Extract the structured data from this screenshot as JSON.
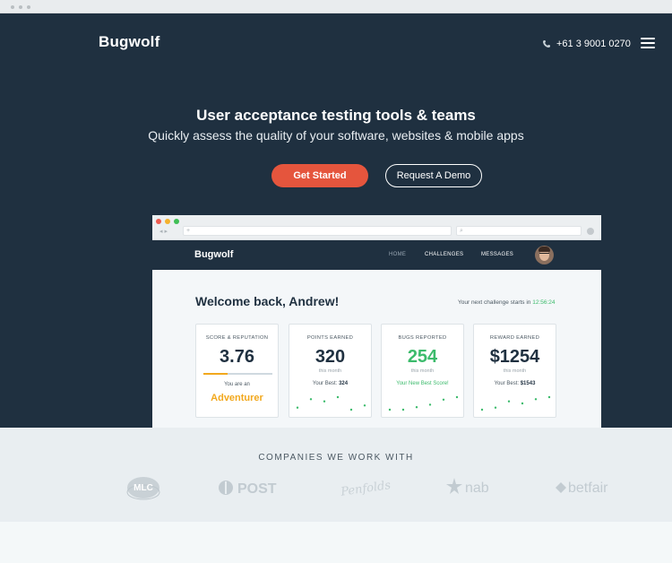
{
  "brand": {
    "name": "Bugwolf"
  },
  "header": {
    "phone": "+61 3 9001 0270",
    "phone_icon": "phone-icon",
    "menu_icon": "hamburger-menu-icon"
  },
  "hero": {
    "title": "User acceptance testing tools & teams",
    "subtitle": "Quickly assess the quality of your software, websites & mobile apps",
    "primary_cta": "Get Started",
    "secondary_cta": "Request A Demo"
  },
  "mock_app": {
    "logo": "Bugwolf",
    "nav": [
      {
        "label": "HOME",
        "active": true
      },
      {
        "label": "CHALLENGES",
        "active": false
      },
      {
        "label": "MESSAGES",
        "active": false
      }
    ],
    "welcome": "Welcome back, Andrew!",
    "next_challenge_label": "Your next challenge starts in",
    "next_challenge_time": "12:56:24",
    "cards": {
      "reputation": {
        "title": "SCORE & REPUTATION",
        "value": "3.76",
        "progress": 0.35,
        "label": "You are an",
        "rank": "Adventurer"
      },
      "points": {
        "title": "POINTS EARNED",
        "value": "320",
        "period": "this month",
        "best_label": "Your Best:",
        "best_value": "324",
        "trend": [
          2,
          6,
          5,
          7,
          1,
          3
        ]
      },
      "bugs": {
        "title": "BUGS REPORTED",
        "value": "254",
        "period": "this month",
        "note": "Your New Best Score!",
        "trend": [
          2,
          2,
          3,
          4,
          6,
          7
        ]
      },
      "reward": {
        "title": "REWARD EARNED",
        "value": "$1254",
        "period": "this month",
        "best_label": "Your Best:",
        "best_value": "$1543",
        "trend": [
          1,
          2,
          5,
          4,
          6,
          7
        ]
      }
    }
  },
  "companies": {
    "title": "COMPANIES WE WORK WITH",
    "logos": [
      "MLC",
      "POST",
      "Penfolds",
      "nab",
      "betfair"
    ]
  },
  "colors": {
    "navy": "#1f3040",
    "accent": "#e5553d",
    "green": "#3cbb6c",
    "gold": "#f2a81d"
  }
}
